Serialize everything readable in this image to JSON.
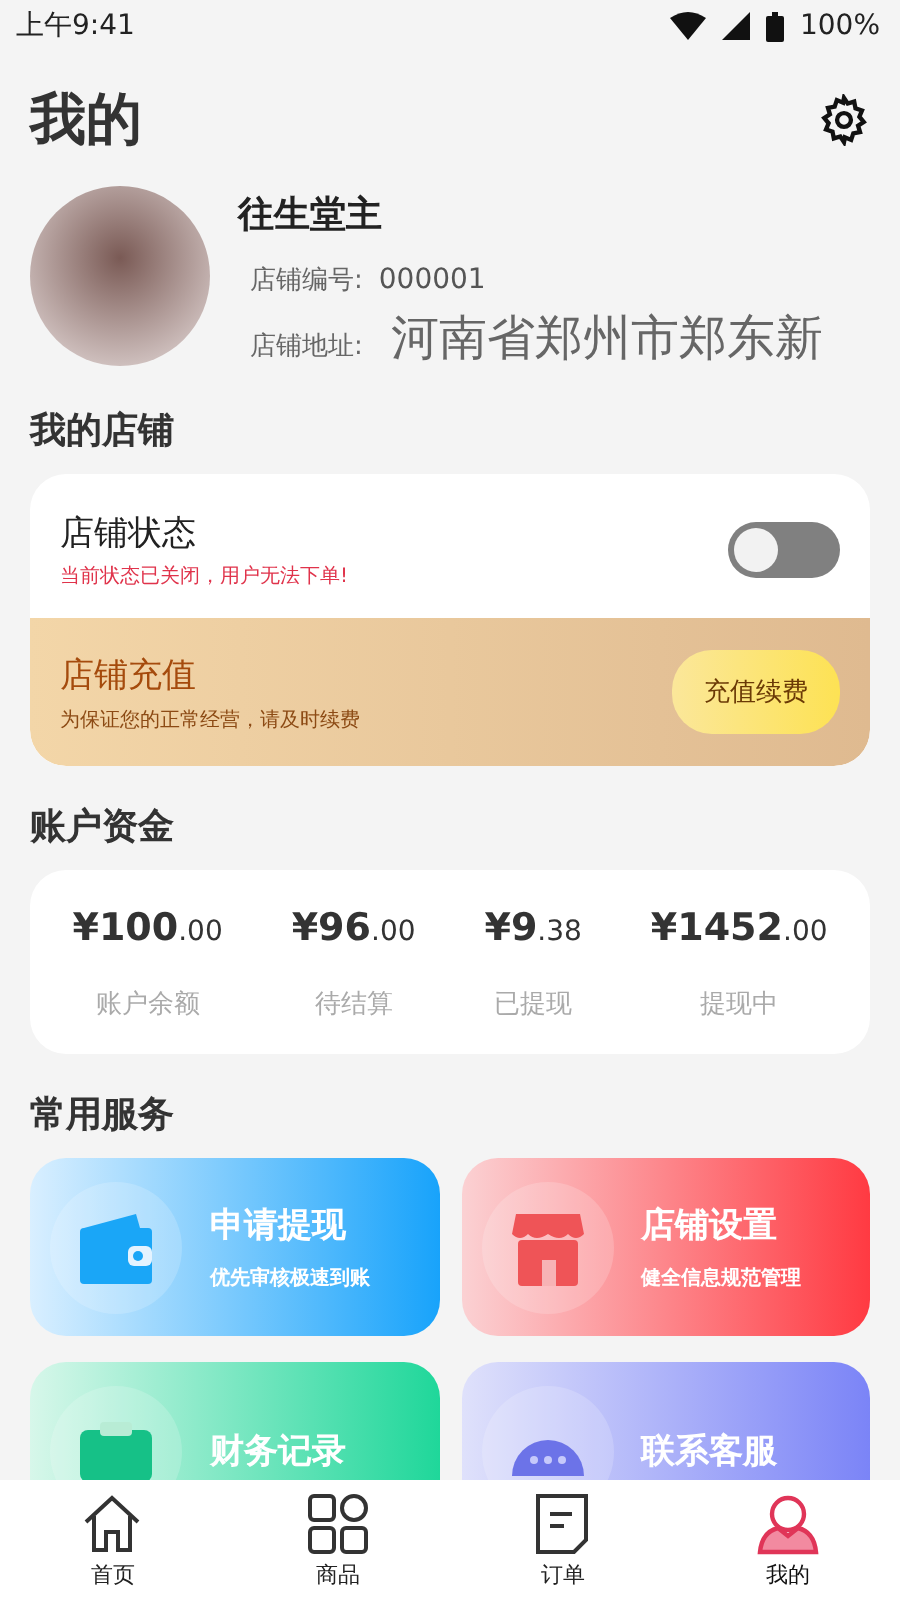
{
  "status_bar": {
    "time": "上午9:41",
    "battery": "100%"
  },
  "header": {
    "title": "我的"
  },
  "profile": {
    "name": "往生堂主",
    "id_label": "店铺编号:",
    "id_value": "000001",
    "address_label": "店铺地址:",
    "address_value": "河南省郑州市郑东新"
  },
  "shop": {
    "title": "我的店铺",
    "status_title": "店铺状态",
    "status_note": "当前状态已关闭，用户无法下单!",
    "open": false,
    "recharge_title": "店铺充值",
    "recharge_note": "为保证您的正常经营，请及时续费",
    "recharge_button": "充值续费"
  },
  "funds": {
    "title": "账户资金",
    "items": [
      {
        "integer": "¥100",
        "fraction": ".00",
        "label": "账户余额"
      },
      {
        "integer": "¥96",
        "fraction": ".00",
        "label": "待结算"
      },
      {
        "integer": "¥9",
        "fraction": ".38",
        "label": "已提现"
      },
      {
        "integer": "¥1452",
        "fraction": ".00",
        "label": "提现中"
      }
    ]
  },
  "services": {
    "title": "常用服务",
    "items": [
      {
        "kind": "wallet",
        "title": "申请提现",
        "subtitle": "优先审核极速到账"
      },
      {
        "kind": "store",
        "title": "店铺设置",
        "subtitle": "健全信息规范管理"
      },
      {
        "kind": "records",
        "title": "财务记录"
      },
      {
        "kind": "chat",
        "title": "联系客服"
      }
    ]
  },
  "tabs": [
    {
      "kind": "home",
      "label": "首页",
      "selected": false
    },
    {
      "kind": "goods",
      "label": "商品",
      "selected": false
    },
    {
      "kind": "orders",
      "label": "订单",
      "selected": false
    },
    {
      "kind": "me",
      "label": "我的",
      "selected": true
    }
  ]
}
